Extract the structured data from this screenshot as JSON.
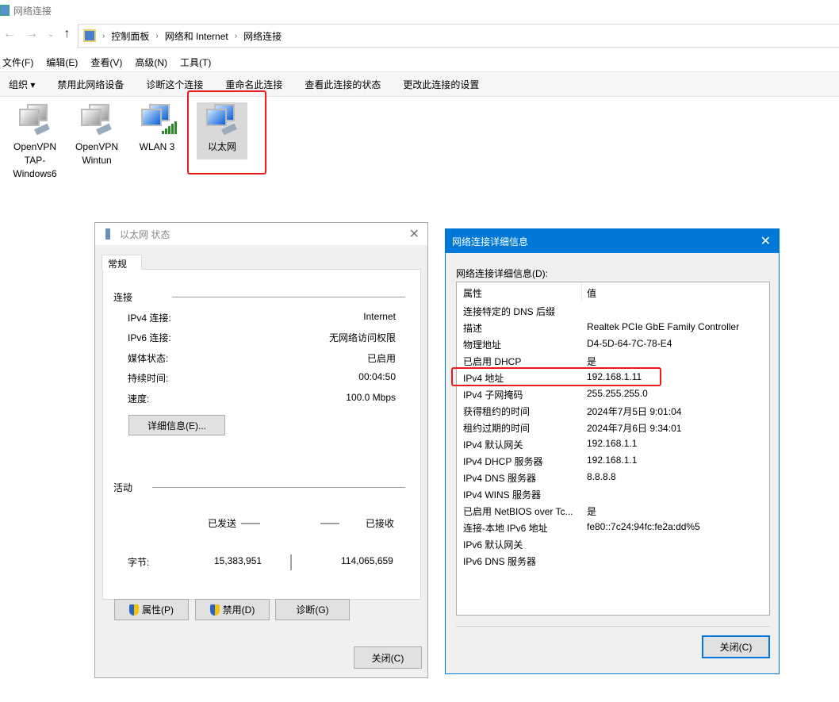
{
  "window": {
    "title": "网络连接"
  },
  "address": {
    "crumbs": [
      "控制面板",
      "网络和 Internet",
      "网络连接"
    ]
  },
  "menu": [
    "文件(F)",
    "编辑(E)",
    "查看(V)",
    "高级(N)",
    "工具(T)"
  ],
  "toolbar": {
    "organize": "组织 ▾",
    "items": [
      "禁用此网络设备",
      "诊断这个连接",
      "重命名此连接",
      "查看此连接的状态",
      "更改此连接的设置"
    ]
  },
  "connections": [
    {
      "label": "OpenVPN TAP-Windows6",
      "icon": "ethernet-gray"
    },
    {
      "label": "OpenVPN Wintun",
      "icon": "ethernet-gray"
    },
    {
      "label": "WLAN 3",
      "icon": "wifi"
    },
    {
      "label": "以太网",
      "icon": "ethernet",
      "selected": true
    }
  ],
  "status": {
    "title": "以太网 状态",
    "tab": "常规",
    "connection_group": "连接",
    "rows": [
      {
        "k": "IPv4 连接:",
        "v": "Internet"
      },
      {
        "k": "IPv6 连接:",
        "v": "无网络访问权限"
      },
      {
        "k": "媒体状态:",
        "v": "已启用"
      },
      {
        "k": "持续时间:",
        "v": "00:04:50"
      },
      {
        "k": "速度:",
        "v": "100.0 Mbps"
      }
    ],
    "details_btn": "详细信息(E)...",
    "activity_group": "活动",
    "sent": "已发送",
    "received": "已接收",
    "bytes_label": "字节:",
    "bytes_sent": "15,383,951",
    "bytes_received": "114,065,659",
    "properties_btn": "属性(P)",
    "disable_btn": "禁用(D)",
    "diagnose_btn": "诊断(G)",
    "close_btn": "关闭(C)"
  },
  "details": {
    "title": "网络连接详细信息",
    "label": "网络连接详细信息(D):",
    "col_prop": "属性",
    "col_val": "值",
    "rows": [
      {
        "k": "连接特定的 DNS 后缀",
        "v": ""
      },
      {
        "k": "描述",
        "v": "Realtek PCIe GbE Family Controller"
      },
      {
        "k": "物理地址",
        "v": "D4-5D-64-7C-78-E4"
      },
      {
        "k": "已启用 DHCP",
        "v": "是"
      },
      {
        "k": "IPv4 地址",
        "v": "192.168.1.11"
      },
      {
        "k": "IPv4 子网掩码",
        "v": "255.255.255.0"
      },
      {
        "k": "获得租约的时间",
        "v": "2024年7月5日 9:01:04"
      },
      {
        "k": "租约过期的时间",
        "v": "2024年7月6日 9:34:01"
      },
      {
        "k": "IPv4 默认网关",
        "v": "192.168.1.1"
      },
      {
        "k": "IPv4 DHCP 服务器",
        "v": "192.168.1.1"
      },
      {
        "k": "IPv4 DNS 服务器",
        "v": "8.8.8.8"
      },
      {
        "k": "IPv4 WINS 服务器",
        "v": ""
      },
      {
        "k": "已启用 NetBIOS over Tc...",
        "v": "是"
      },
      {
        "k": "连接-本地 IPv6 地址",
        "v": "fe80::7c24:94fc:fe2a:dd%5"
      },
      {
        "k": "IPv6 默认网关",
        "v": ""
      },
      {
        "k": "IPv6 DNS 服务器",
        "v": ""
      }
    ],
    "close_btn": "关闭(C)"
  },
  "colors": {
    "accent": "#0078d7",
    "highlight": "#e81c1c"
  }
}
